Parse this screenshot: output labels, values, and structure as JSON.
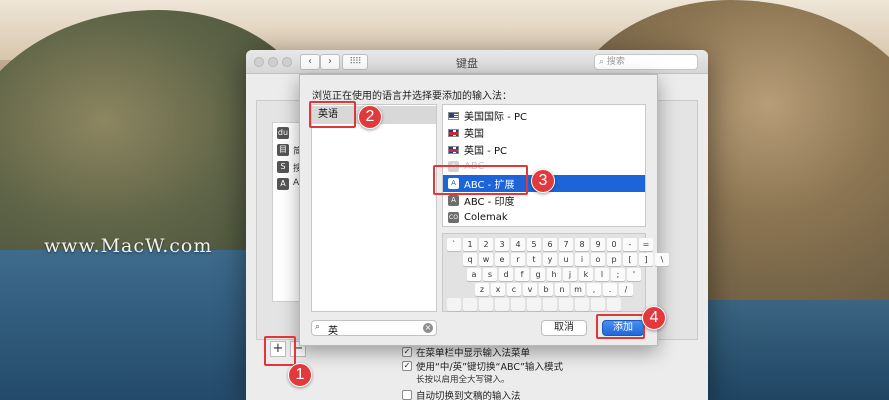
{
  "watermark": "www.MacW.com",
  "window": {
    "title": "键盘",
    "back_glyph": "‹",
    "forward_glyph": "›",
    "grid_glyph": "⠿⠿",
    "search_placeholder": "搜索",
    "plus_label": "+",
    "minus_label": "−"
  },
  "left_list": {
    "items": [
      {
        "icon": "du",
        "label": ""
      },
      {
        "icon": "目",
        "label": "简"
      },
      {
        "icon": "S",
        "label": "搜"
      },
      {
        "icon": "A",
        "label": "A"
      }
    ]
  },
  "options": {
    "show_menu": {
      "label": "在菜单栏中显示输入法菜单",
      "checked": true
    },
    "switch_abc": {
      "label": "使用“中/英”键切换“ABC”输入模式",
      "checked": true
    },
    "switch_hint": "长按以启用全大写键入。",
    "auto_switch": {
      "label": "自动切换到文稿的输入法",
      "checked": false
    }
  },
  "sheet": {
    "title": "浏览正在使用的语言并选择要添加的输入法：",
    "languages": [
      {
        "label": "英语",
        "selected": true
      }
    ],
    "input_methods": [
      {
        "label": "美国国际 - PC",
        "icon": "flag-us",
        "selected": false,
        "faded": false
      },
      {
        "label": "英国",
        "icon": "flag-gb",
        "selected": false,
        "faded": false
      },
      {
        "label": "英国 - PC",
        "icon": "flag-gb",
        "selected": false,
        "faded": false
      },
      {
        "label": "ABC",
        "icon": "keyboard-a",
        "selected": false,
        "faded": true
      },
      {
        "label": "ABC - 扩展",
        "icon": "keyboard-a",
        "selected": true,
        "faded": false
      },
      {
        "label": "ABC - 印度",
        "icon": "keyboard-a",
        "selected": false,
        "faded": false
      },
      {
        "label": "Colemak",
        "icon": "keyboard-co",
        "selected": false,
        "faded": false
      }
    ],
    "keyboard_rows": [
      [
        "`",
        "1",
        "2",
        "3",
        "4",
        "5",
        "6",
        "7",
        "8",
        "9",
        "0",
        "-",
        "="
      ],
      [
        "q",
        "w",
        "e",
        "r",
        "t",
        "y",
        "u",
        "i",
        "o",
        "p",
        "[",
        "]",
        "\\"
      ],
      [
        "a",
        "s",
        "d",
        "f",
        "g",
        "h",
        "j",
        "k",
        "l",
        ";",
        "'"
      ],
      [
        "z",
        "x",
        "c",
        "v",
        "b",
        "n",
        "m",
        ",",
        ".",
        "/"
      ],
      [
        "",
        "",
        "",
        "",
        "",
        "",
        "",
        "",
        "",
        "",
        ""
      ]
    ],
    "search_value": "英",
    "search_icon_glyph": "🔍",
    "clear_glyph": "×",
    "cancel_label": "取消",
    "add_label": "添加"
  },
  "annotations": {
    "badges": [
      "1",
      "2",
      "3",
      "4"
    ],
    "color": "#e0383a"
  }
}
